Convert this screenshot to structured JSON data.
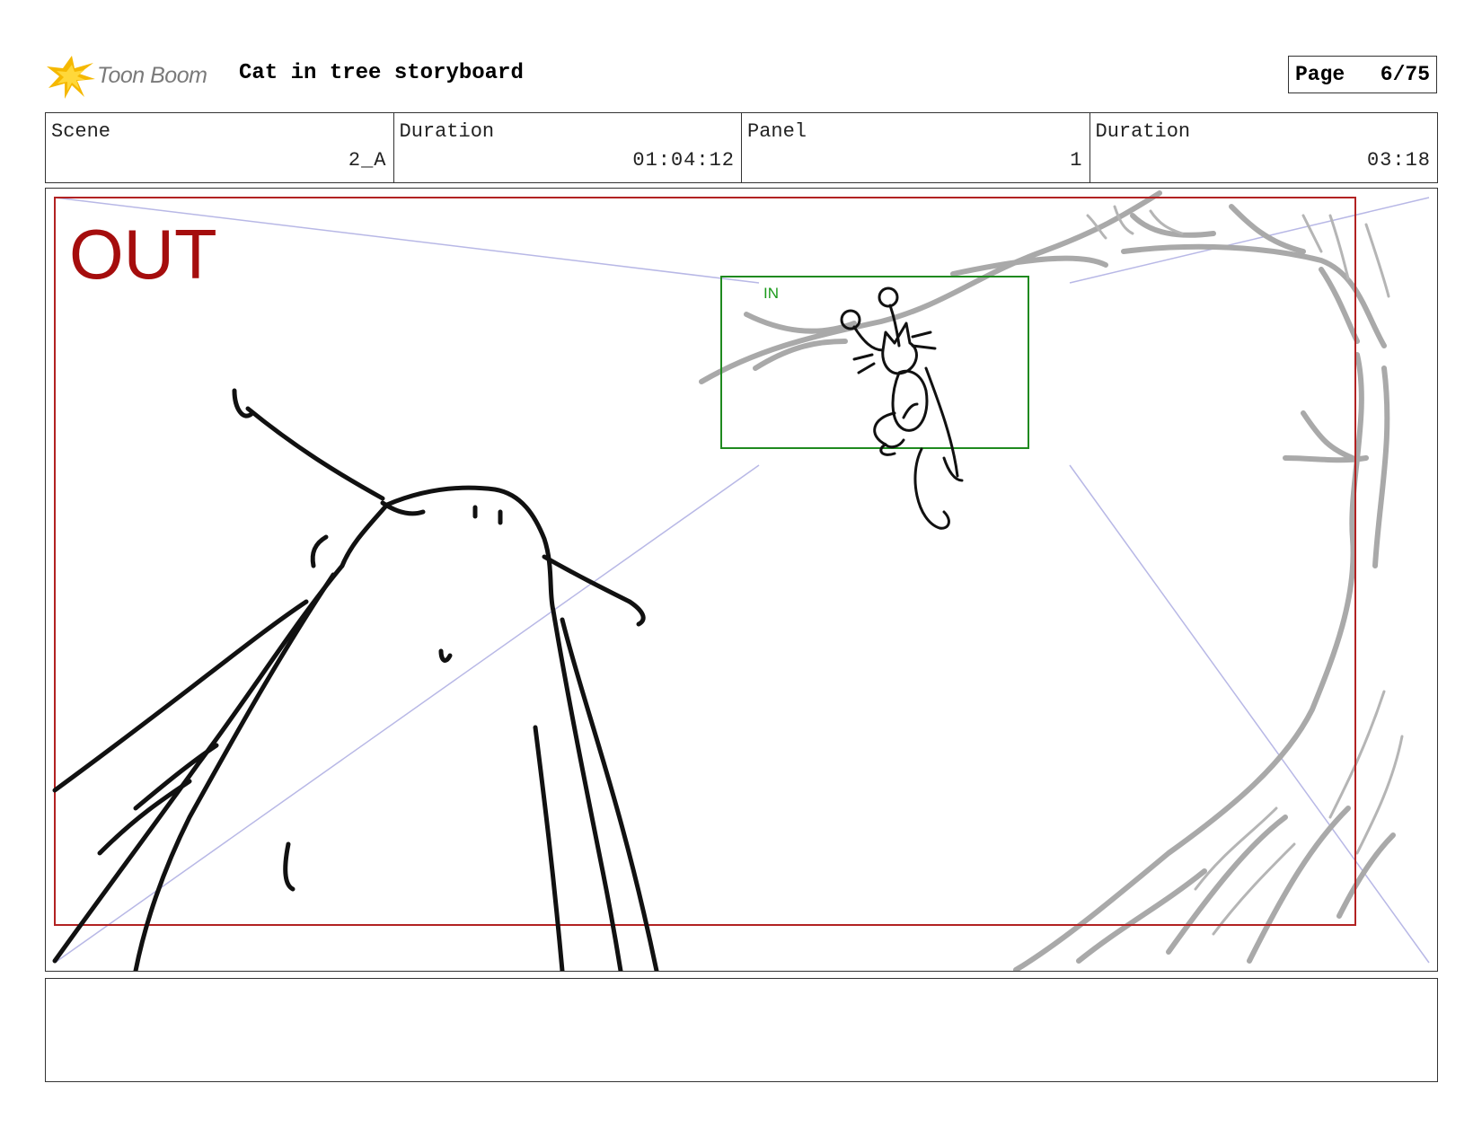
{
  "header": {
    "brand": "Toon Boom",
    "title": "Cat in tree storyboard",
    "page_label": "Page",
    "page_value": "6/75"
  },
  "info": {
    "scene_label": "Scene",
    "scene_value": "2_A",
    "scene_duration_label": "Duration",
    "scene_duration_value": "01:04:12",
    "panel_label": "Panel",
    "panel_value": "1",
    "panel_duration_label": "Duration",
    "panel_duration_value": "03:18"
  },
  "panel": {
    "out_label": "OUT",
    "in_label": "IN"
  },
  "colors": {
    "out_frame": "#b22222",
    "in_frame": "#1f8a1f",
    "camera_lines": "#b8b8e6",
    "tree": "#a9a9a9",
    "ink": "#111111",
    "logo_star": "#f5b800"
  },
  "icons": {
    "logo": "toon-boom-star-logo"
  },
  "notes": {
    "text": ""
  }
}
